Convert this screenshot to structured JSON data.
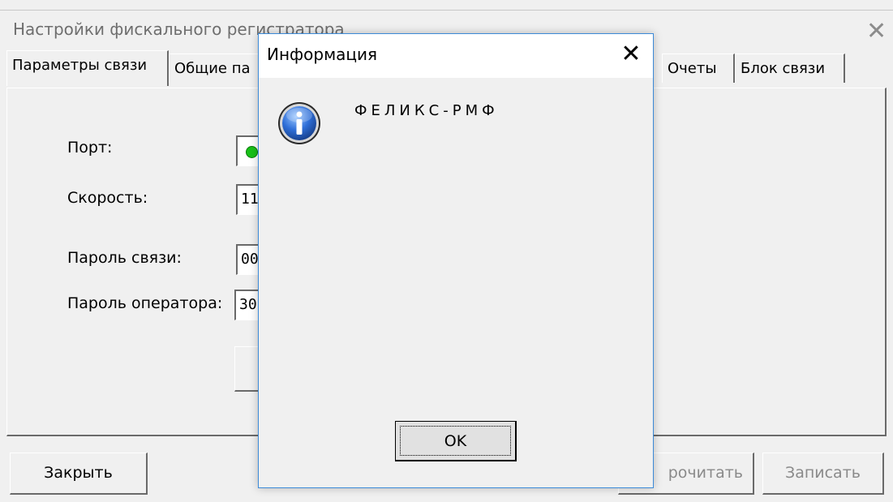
{
  "window": {
    "title": "Настройки фискального регистратора",
    "close_glyph": "✕",
    "tabs": [
      {
        "label": "Параметры связи"
      },
      {
        "label": "Общие па"
      },
      {
        "label": "Очеты"
      },
      {
        "label": "Блок связи"
      }
    ],
    "form": {
      "port_label": "Порт:",
      "speed_label": "Скорость:",
      "speed_value": "11",
      "link_password_label": "Пароль связи:",
      "link_password_value": "00",
      "operator_password_label": "Пароль оператора:",
      "operator_password_value": "30",
      "port_status_color": "#18c018"
    },
    "footer": {
      "close_button": "Закрыть",
      "read_button": "рочитать",
      "write_button": "Записать"
    }
  },
  "dialog": {
    "title": "Информация",
    "close_glyph": "✕",
    "icon": "info-icon",
    "message": "ФЕЛИКС-РМФ",
    "ok_button": "OK",
    "accent_color": "#3c8ad8"
  }
}
